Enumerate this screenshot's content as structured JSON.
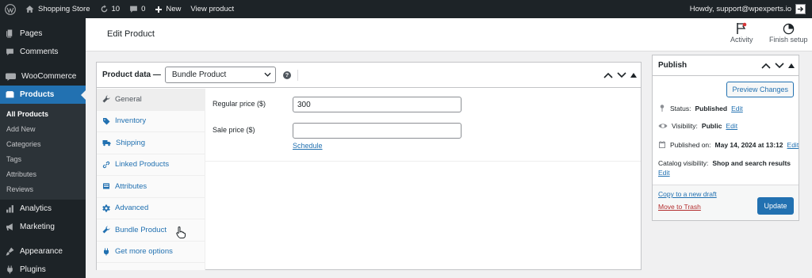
{
  "adminbar": {
    "site_name": "Shopping Store",
    "updates_count": "10",
    "comments_count": "0",
    "new_label": "New",
    "view_label": "View product",
    "howdy": "Howdy, support@wpexperts.io"
  },
  "sidebar": {
    "items": [
      {
        "label": "Pages",
        "icon": "pages-icon"
      },
      {
        "label": "Comments",
        "icon": "comments-icon"
      },
      {
        "label": "WooCommerce",
        "icon": "woocommerce-icon"
      },
      {
        "label": "Products",
        "icon": "products-icon"
      },
      {
        "label": "Analytics",
        "icon": "analytics-icon"
      },
      {
        "label": "Marketing",
        "icon": "marketing-icon"
      },
      {
        "label": "Appearance",
        "icon": "appearance-icon"
      },
      {
        "label": "Plugins",
        "icon": "plugins-icon"
      }
    ],
    "submenu": [
      "All Products",
      "Add New",
      "Categories",
      "Tags",
      "Attributes",
      "Reviews"
    ]
  },
  "header": {
    "title": "Edit Product",
    "activity_label": "Activity",
    "finish_setup_label": "Finish setup"
  },
  "product_data": {
    "title": "Product data —",
    "type_selected": "Bundle Product",
    "tabs": [
      {
        "label": "General",
        "icon": "wrench-icon"
      },
      {
        "label": "Inventory",
        "icon": "tag-icon"
      },
      {
        "label": "Shipping",
        "icon": "truck-icon"
      },
      {
        "label": "Linked Products",
        "icon": "link-icon"
      },
      {
        "label": "Attributes",
        "icon": "list-icon"
      },
      {
        "label": "Advanced",
        "icon": "gear-icon"
      },
      {
        "label": "Bundle Product",
        "icon": "wrench-icon"
      },
      {
        "label": "Get more options",
        "icon": "plugin-icon"
      }
    ],
    "regular_price_label": "Regular price ($)",
    "regular_price_value": "300",
    "sale_price_label": "Sale price ($)",
    "sale_price_value": "",
    "schedule_label": "Schedule"
  },
  "publish": {
    "title": "Publish",
    "preview_label": "Preview Changes",
    "status_label": "Status:",
    "status_value": "Published",
    "visibility_label": "Visibility:",
    "visibility_value": "Public",
    "published_label": "Published on:",
    "published_value": "May 14, 2024 at 13:12",
    "catalog_label": "Catalog visibility:",
    "catalog_value": "Shop and search results",
    "edit_label": "Edit",
    "copy_label": "Copy to a new draft",
    "trash_label": "Move to Trash",
    "update_label": "Update"
  },
  "colors": {
    "accent": "#2271b1",
    "adminbar_bg": "#1d2327",
    "trash": "#b32d2e"
  }
}
